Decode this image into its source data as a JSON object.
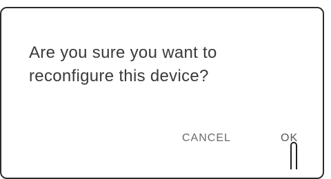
{
  "dialog": {
    "message_line1": "Are you sure you want to",
    "message_line2": "reconfigure this device?",
    "buttons": {
      "cancel_label": "CANCEL",
      "ok_label": "OK"
    }
  },
  "icons": {
    "pointer": "stylus-icon"
  },
  "colors": {
    "border": "#2b2b2b",
    "message_text": "#3a3a3a",
    "button_text": "#6a6a6a",
    "background": "#ffffff"
  }
}
